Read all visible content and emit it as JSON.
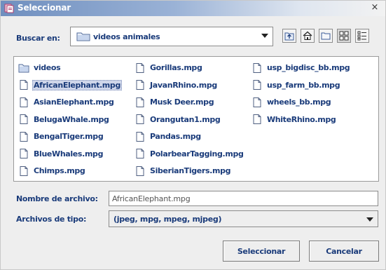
{
  "window": {
    "title": "Seleccionar",
    "close_glyph": "×"
  },
  "lookin": {
    "label": "Buscar en:",
    "value": "videos animales",
    "buttons": [
      "up-folder-icon",
      "home-icon",
      "new-folder-icon",
      "list-view-icon",
      "details-view-icon"
    ]
  },
  "files": [
    {
      "name": "videos",
      "type": "folder"
    },
    {
      "name": "AfricanElephant.mpg",
      "type": "file",
      "selected": true
    },
    {
      "name": "AsianElephant.mpg",
      "type": "file"
    },
    {
      "name": "BelugaWhale.mpg",
      "type": "file"
    },
    {
      "name": "BengalTiger.mpg",
      "type": "file"
    },
    {
      "name": "BlueWhales.mpg",
      "type": "file"
    },
    {
      "name": "Chimps.mpg",
      "type": "file"
    },
    {
      "name": "Gorillas.mpg",
      "type": "file"
    },
    {
      "name": "JavanRhino.mpg",
      "type": "file"
    },
    {
      "name": "Musk Deer.mpg",
      "type": "file"
    },
    {
      "name": "Orangutan1.mpg",
      "type": "file"
    },
    {
      "name": "Pandas.mpg",
      "type": "file"
    },
    {
      "name": "PolarbearTagging.mpg",
      "type": "file"
    },
    {
      "name": "SiberianTigers.mpg",
      "type": "file"
    },
    {
      "name": "usp_bigdisc_bb.mpg",
      "type": "file"
    },
    {
      "name": "usp_farm_bb.mpg",
      "type": "file"
    },
    {
      "name": "wheels_bb.mpg",
      "type": "file"
    },
    {
      "name": "WhiteRhino.mpg",
      "type": "file"
    }
  ],
  "filename": {
    "label": "Nombre de archivo:",
    "value": "AfricanElephant.mpg"
  },
  "filetype": {
    "label": "Archivos de tipo:",
    "value": "(jpeg, mpg, mpeg, mjpeg)"
  },
  "actions": {
    "select": "Seleccionar",
    "cancel": "Cancelar"
  },
  "colors": {
    "label_text": "#1a3b7a",
    "selection": "#cfd6ea",
    "title_gradient_start": "#6f8fbf"
  }
}
